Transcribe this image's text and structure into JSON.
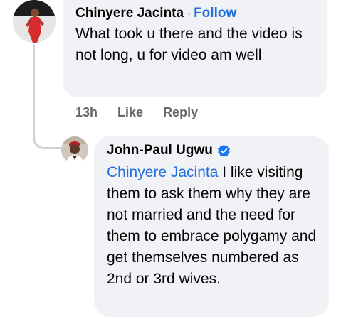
{
  "comment": {
    "author": "Chinyere Jacinta",
    "separator": "·",
    "follow_label": "Follow",
    "text": "What took u there and the video is not long, u for video am well",
    "avatar_icon": "profile-photo-icon"
  },
  "comment_actions": {
    "time": "13h",
    "like_label": "Like",
    "reply_label": "Reply"
  },
  "reply": {
    "author": "John-Paul Ugwu",
    "verified_icon": "verified-badge-icon",
    "mention": "Chinyere Jacinta",
    "text": " I like visiting them to ask them why they are not married and the need for them to embrace polygamy and get themselves numbered as 2nd or 3rd wives.",
    "avatar_icon": "profile-photo-icon"
  },
  "colors": {
    "bubble": "#f0f2f5",
    "link": "#216fdb",
    "muted": "#65676b",
    "thread_line": "#ced0d4"
  }
}
